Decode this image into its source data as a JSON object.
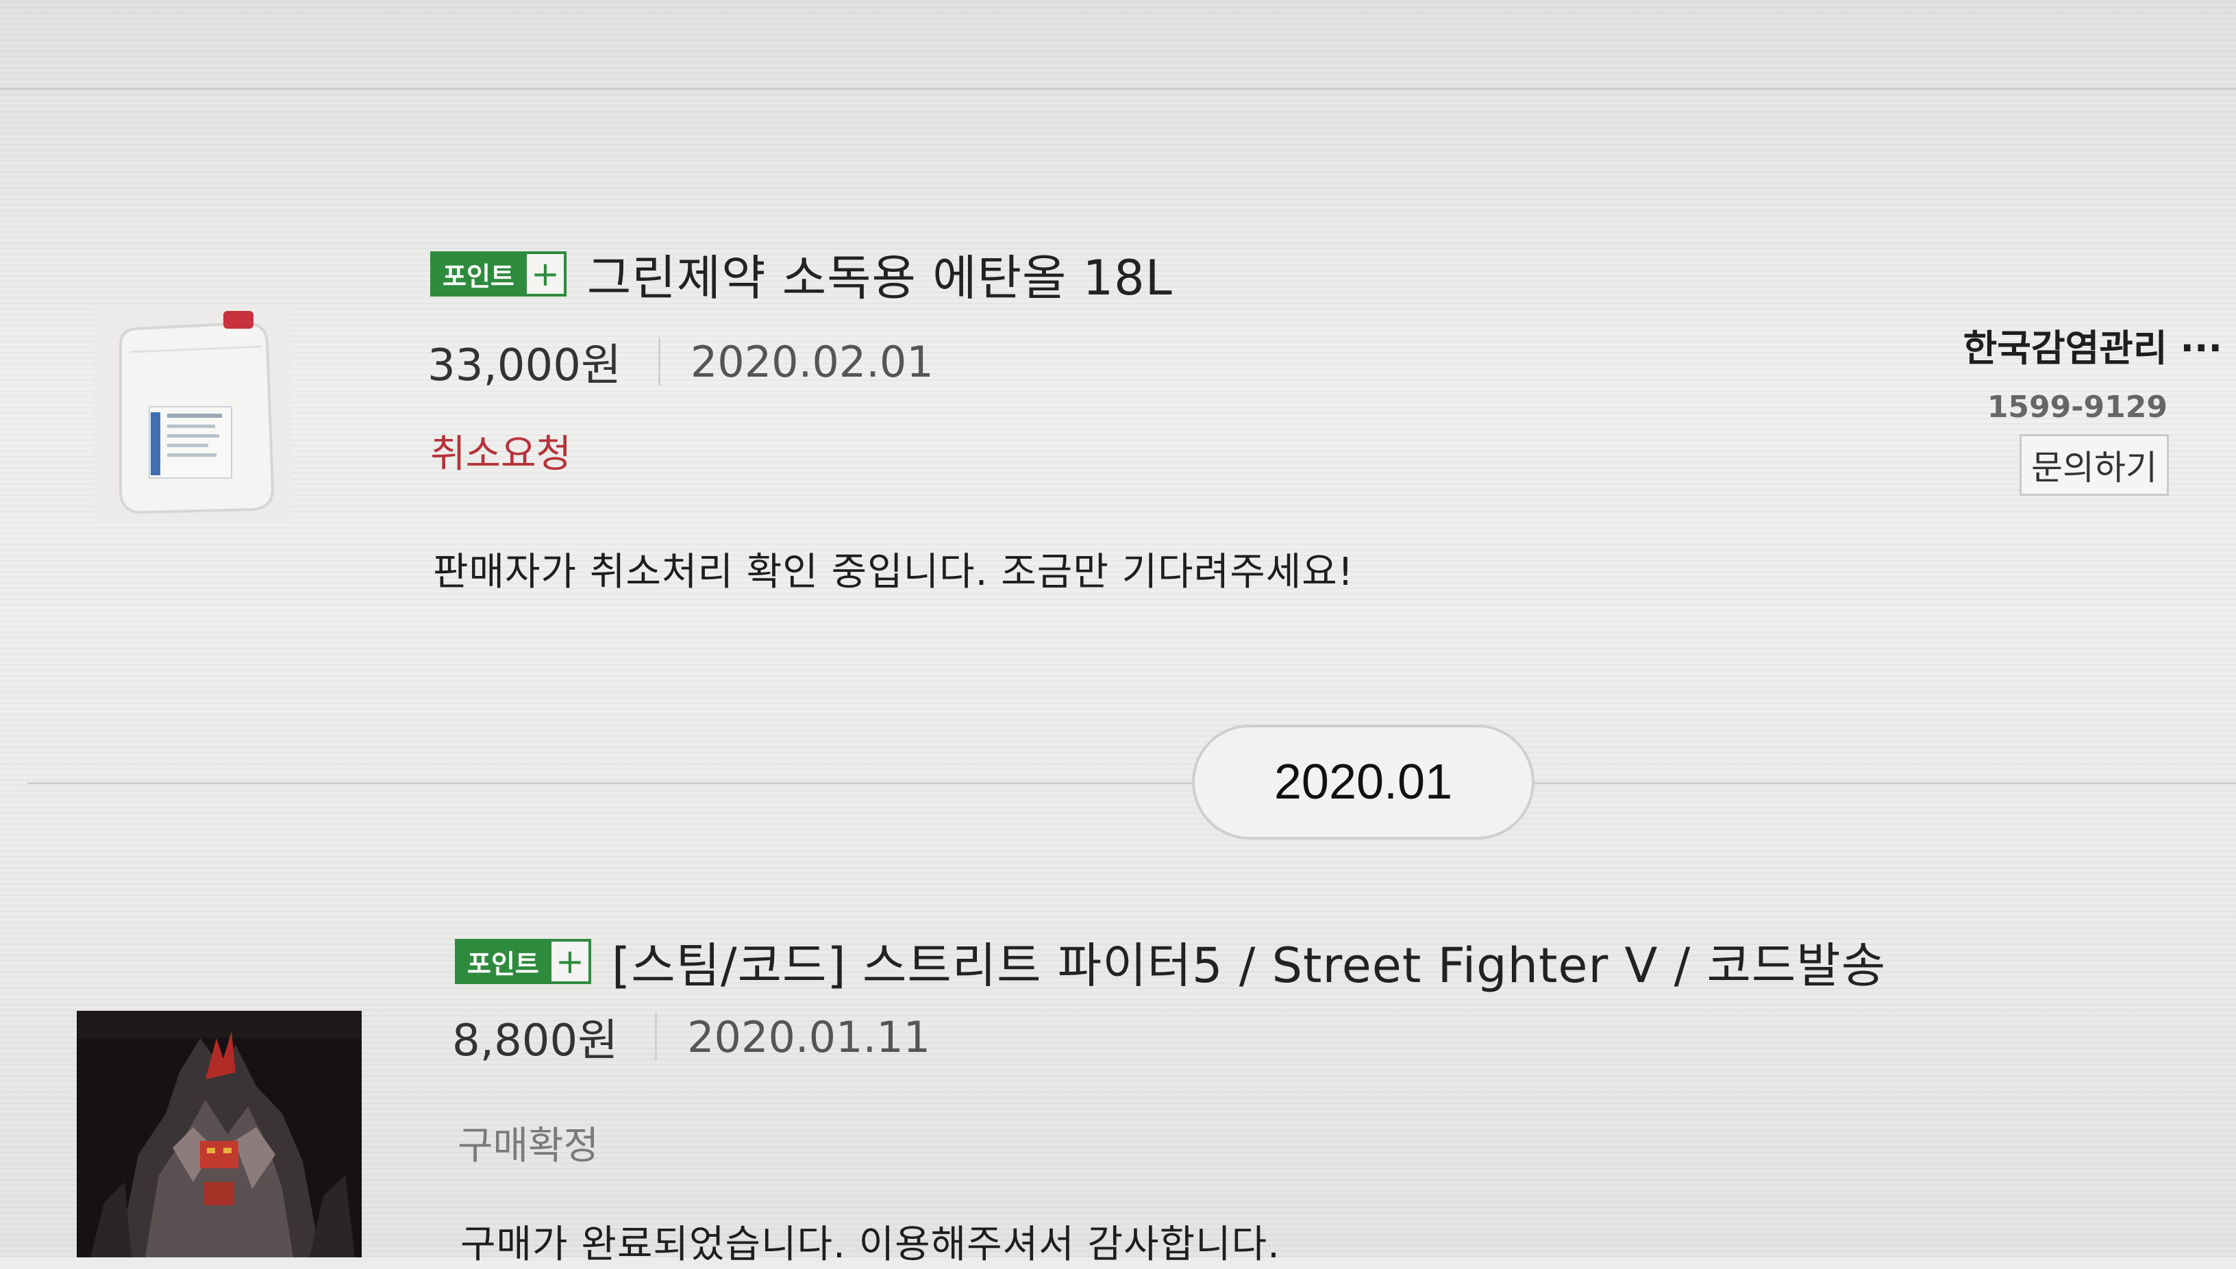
{
  "orders": [
    {
      "badge": {
        "label": "포인트",
        "plus": "+"
      },
      "product_name": "그린제약 소독용 에탄올 18L",
      "price": "33,000원",
      "date": "2020.02.01",
      "status": "취소요청",
      "status_message": "판매자가 취소처리 확인 중입니다. 조금만 기다려주세요!",
      "seller": {
        "name": "한국감염관리 ···",
        "phone": "1599-9129",
        "inquiry_label": "문의하기"
      }
    },
    {
      "badge": {
        "label": "포인트",
        "plus": "+"
      },
      "product_name": "[스팀/코드] 스트리트 파이터5 / Street Fighter V / 코드발송",
      "price": "8,800원",
      "date": "2020.01.11",
      "status": "구매확정",
      "status_message": "구매가 완료되었습니다. 이용해주셔서 감사합니다."
    }
  ],
  "month_divider": "2020.01",
  "colors": {
    "badge_green": "#2e8b3e",
    "cancel_status_red": "#b6323a",
    "confirmed_status_gray": "#7a7a7a"
  }
}
